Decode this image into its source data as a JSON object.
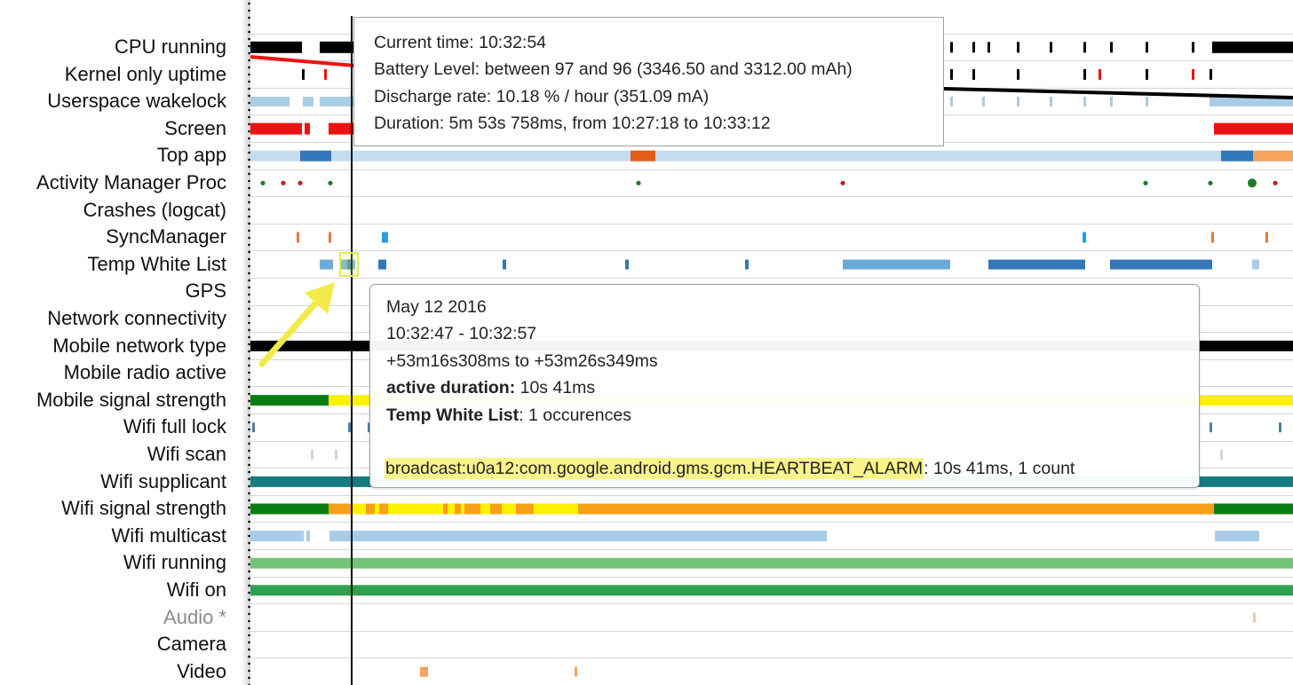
{
  "rows": [
    {
      "label": "CPU running"
    },
    {
      "label": "Kernel only uptime"
    },
    {
      "label": "Userspace wakelock"
    },
    {
      "label": "Screen"
    },
    {
      "label": "Top app"
    },
    {
      "label": "Activity Manager Proc"
    },
    {
      "label": "Crashes (logcat)"
    },
    {
      "label": "SyncManager"
    },
    {
      "label": "Temp White List"
    },
    {
      "label": "GPS"
    },
    {
      "label": "Network connectivity"
    },
    {
      "label": "Mobile network type"
    },
    {
      "label": "Mobile radio active"
    },
    {
      "label": "Mobile signal strength"
    },
    {
      "label": "Wifi full lock"
    },
    {
      "label": "Wifi scan"
    },
    {
      "label": "Wifi supplicant"
    },
    {
      "label": "Wifi signal strength"
    },
    {
      "label": "Wifi multicast"
    },
    {
      "label": "Wifi running"
    },
    {
      "label": "Wifi on"
    },
    {
      "label": "Audio *",
      "muted": true
    },
    {
      "label": "Camera"
    },
    {
      "label": "Video"
    }
  ],
  "battery_tooltip": {
    "current_time": "Current time: 10:32:54",
    "battery_level": "Battery Level: between 97 and 96 (3346.50 and 3312.00 mAh)",
    "discharge_rate": "Discharge rate: 10.18 % / hour (351.09 mA)",
    "duration": "Duration: 5m 53s 758ms, from 10:27:18 to 10:33:12"
  },
  "event_tooltip": {
    "date": "May 12 2016",
    "time_range": "10:32:47 - 10:32:57",
    "offset_range": "+53m16s308ms to +53m26s349ms",
    "active_duration_label": "active duration:",
    "active_duration_value": " 10s 41ms",
    "series_label": "Temp White List",
    "series_value": ": 1 occurences",
    "event_name": "broadcast:u0a12:com.google.android.gms.gcm.HEARTBEAT_ALARM",
    "event_detail": ": 10s 41ms, 1 count"
  },
  "colors": {
    "black": "#000000",
    "red": "#ee1111",
    "light_blue": "#a9cde6",
    "pale_blue": "#c4dcef",
    "mid_blue": "#6aaad6",
    "dark_blue": "#3478b7",
    "bright_blue": "#2a9be0",
    "orange_red": "#e35d17",
    "orange": "#f7a019",
    "light_orange": "#f5a35d",
    "rust": "#e27b3b",
    "yellow": "#fff200",
    "green": "#0a7d12",
    "dot_green": "#1e7a25",
    "dot_red": "#cc1b1b",
    "teal": "#167c81",
    "wifi_running_green": "#74c47a",
    "wifi_on_green": "#2fa04f",
    "annotation_yellow": "#f1ea4a"
  }
}
